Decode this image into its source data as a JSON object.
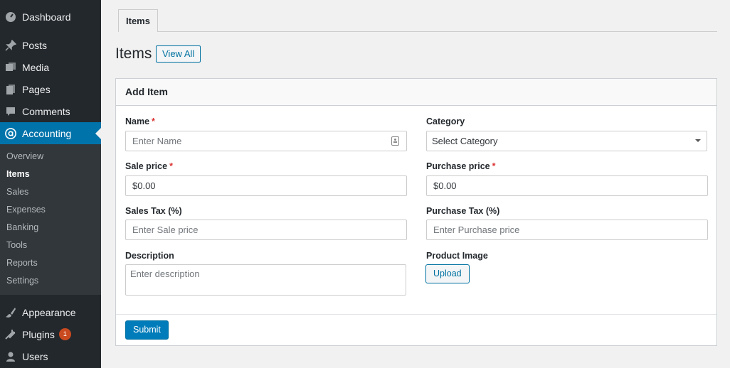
{
  "sidebar": {
    "top_items": [
      {
        "label": "Dashboard",
        "icon": "dashboard-icon"
      },
      {
        "label": "Posts",
        "icon": "pin-icon"
      },
      {
        "label": "Media",
        "icon": "media-icon"
      },
      {
        "label": "Pages",
        "icon": "pages-icon"
      },
      {
        "label": "Comments",
        "icon": "comment-icon"
      },
      {
        "label": "Accounting",
        "icon": "accounting-icon"
      }
    ],
    "submenu": [
      "Overview",
      "Items",
      "Sales",
      "Expenses",
      "Banking",
      "Tools",
      "Reports",
      "Settings"
    ],
    "bottom_items": [
      {
        "label": "Appearance",
        "icon": "brush-icon"
      },
      {
        "label": "Plugins",
        "icon": "plugin-icon",
        "badge": "1"
      },
      {
        "label": "Users",
        "icon": "user-icon"
      }
    ]
  },
  "tabs": {
    "items": "Items"
  },
  "header": {
    "title": "Items",
    "view_all": "View All"
  },
  "form": {
    "card_title": "Add Item",
    "required_mark": "*",
    "name": {
      "label": "Name",
      "placeholder": "Enter Name"
    },
    "category": {
      "label": "Category",
      "value": "Select Category"
    },
    "sale_price": {
      "label": "Sale price",
      "value": "$0.00"
    },
    "purchase_price": {
      "label": "Purchase price",
      "value": "$0.00"
    },
    "sales_tax": {
      "label": "Sales Tax (%)",
      "placeholder": "Enter Sale price"
    },
    "purchase_tax": {
      "label": "Purchase Tax (%)",
      "placeholder": "Enter Purchase price"
    },
    "description": {
      "label": "Description",
      "placeholder": "Enter description"
    },
    "product_image": {
      "label": "Product Image",
      "upload": "Upload"
    },
    "submit": "Submit"
  },
  "colors": {
    "sidebar_bg": "#23282d",
    "accent": "#0073aa",
    "required": "#dc3232",
    "badge": "#ca4a1f"
  }
}
